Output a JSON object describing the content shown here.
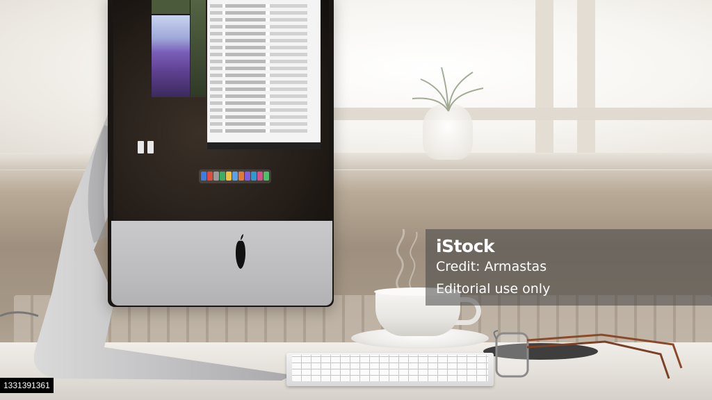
{
  "watermark": {
    "logo": "iStock",
    "credit": "Credit: Armastas",
    "usage": "Editorial use only"
  },
  "image_id": "1331391361",
  "scene": {
    "subjects": [
      "imac-computer",
      "keyboard",
      "coffee-cup",
      "saucer",
      "eyeglasses",
      "trackpad",
      "window",
      "plant"
    ]
  },
  "colors": {
    "watermark_bg": "#464646",
    "desk": "#e8e4de",
    "aluminium": "#c4c4c6"
  }
}
